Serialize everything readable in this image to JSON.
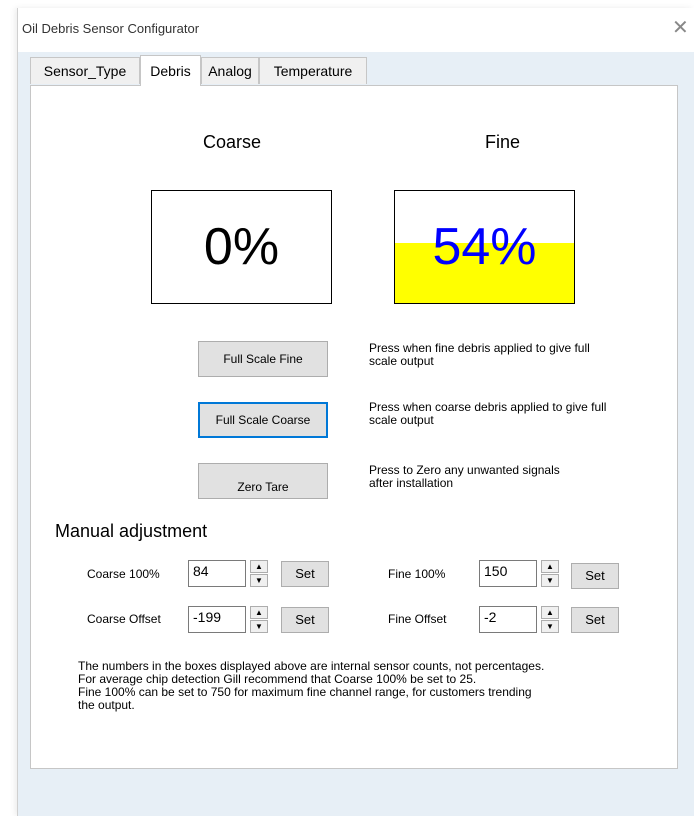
{
  "window": {
    "title": "Oil Debris Sensor Configurator",
    "close_glyph": "✕"
  },
  "tabs": [
    {
      "label": "Sensor_Type",
      "active": false
    },
    {
      "label": "Debris",
      "active": true
    },
    {
      "label": "Analog",
      "active": false
    },
    {
      "label": "Temperature",
      "active": false
    }
  ],
  "debris": {
    "coarse": {
      "heading": "Coarse",
      "value_text": "0%",
      "level": 0,
      "text_color": "#000000"
    },
    "fine": {
      "heading": "Fine",
      "value_text": "54%",
      "level": 0.54,
      "text_color": "#0000ff",
      "fill_color": "#ffff00"
    },
    "buttons": [
      {
        "label": "Full Scale Fine",
        "help": [
          "Press when fine debris applied to give full",
          "scale output"
        ]
      },
      {
        "label": "Full Scale Coarse",
        "help": [
          "Press when coarse debris applied to give full",
          "scale output"
        ]
      },
      {
        "label": "Zero Tare",
        "help": [
          "Press to Zero any unwanted signals",
          "after installation"
        ]
      }
    ],
    "manual": {
      "heading": "Manual adjustment",
      "set_label": "Set",
      "fields": [
        {
          "label": "Coarse 100%",
          "value": "84"
        },
        {
          "label": "Coarse Offset",
          "value": "-199"
        },
        {
          "label": "Fine 100%",
          "value": "150"
        },
        {
          "label": "Fine Offset",
          "value": "-2"
        }
      ]
    },
    "note": [
      "The numbers in the boxes displayed above are internal sensor counts, not percentages.",
      "For average chip detection Gill recommend that Coarse 100% be set to 25.",
      "Fine 100% can be set to 750 for maximum fine channel range, for customers trending",
      "the output."
    ]
  },
  "colors": {
    "accent": "#0078d7",
    "frame": "#e7eff6"
  }
}
